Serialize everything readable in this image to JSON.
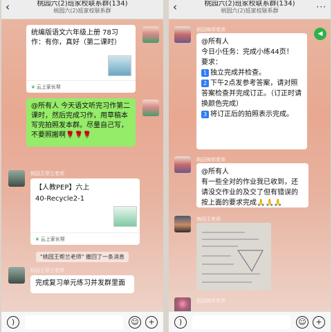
{
  "left": {
    "title": "桃园六(2)班家校联系群(134)",
    "subtitle": "桃园六(2)班家校联系群",
    "msg1": "统编版语文六年级上册 78习作：有你，真好（第二课时）",
    "msg1_footer": "云上家长帮",
    "msg2": "@所有人 今天语文听完习作第二课时，然后完成习作，用草稿本写完拍照发本群。尽量自己写，不要照搬啊🌹🌹🌹",
    "sender1": "桃园王帮兰老师",
    "msg3_line1": "【人教PEP】六上",
    "msg3_line2": "40-Recycle2-1",
    "msg3_footer": "云上家长帮",
    "notice": "\"桃园王帮兰老师\" 撤回了一条消息",
    "sender2": "桃园王帮兰老师",
    "msg4": "完成复习单元练习并发群里面"
  },
  "right": {
    "title": "桃园六(2)班家校联系群(134)",
    "subtitle": "桃园六(2)班家校联系群",
    "sender1": "桃园梅琴老师",
    "msg1_l1": "@所有人",
    "msg1_l2": "今日小任务：完成小练44页！",
    "msg1_l3": "要求：",
    "item1_num": "1",
    "item1": "独立完成并检查。",
    "item2_num": "2",
    "item2": "下午2点发参考答案，请对照答案检查并完成订正。（订正时请换颜色完成）",
    "item3_num": "3",
    "item3": "将订正后的拍照表示完成。",
    "sender2": "桃园梅琴老师",
    "msg2_l1": "@所有人",
    "msg2_l2": "有一些全对的作业我已收到，还请没交作业的及交了但有错误的按上面的要求完成🙏🙏🙏",
    "sender3": "梅园王老师",
    "sender4": "桃园梅琴老师"
  },
  "icons": {
    "back": "chevron-left-icon",
    "more": "more-icon",
    "voice": "voice-icon",
    "emoji": "emoji-icon",
    "plus": "plus-icon"
  },
  "colors": {
    "green_bubble": "#95ec69",
    "white_bubble": "#ffffff",
    "accent_green": "#2db24a"
  }
}
